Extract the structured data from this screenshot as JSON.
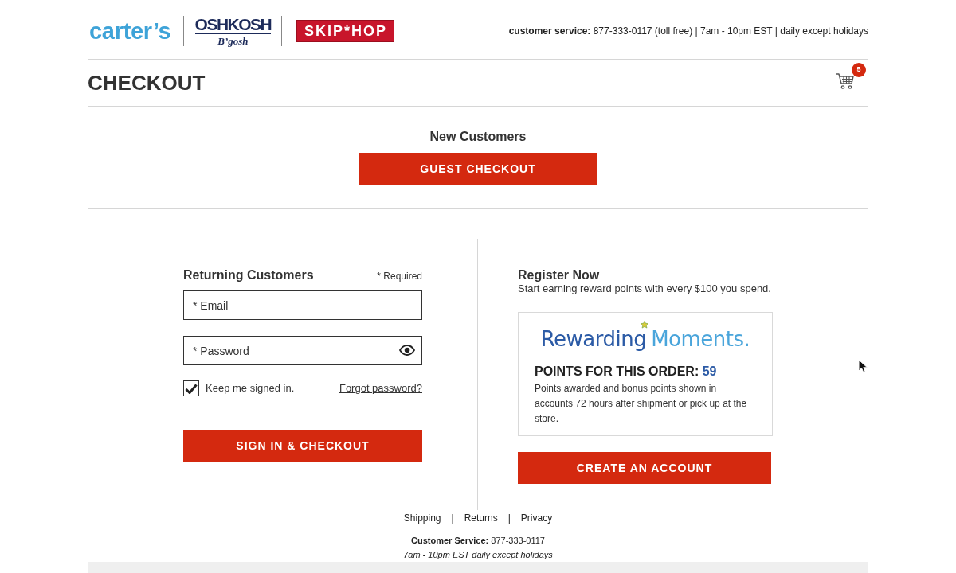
{
  "header": {
    "brands": [
      {
        "kind": "carters",
        "text": "carter’s"
      },
      {
        "kind": "oshkosh",
        "text": "OSHKOSH",
        "subtext": "B’gosh"
      },
      {
        "kind": "skiphop",
        "text": "SKIP*HOP"
      }
    ],
    "service_info": "**customer service:** 877-333-0117 (toll free) |  7am - 10pm EST |  daily except holidays"
  },
  "page_title": "CHECKOUT",
  "cart": {
    "count": "5"
  },
  "new_customers": {
    "heading": "New Customers",
    "button": "GUEST CHECKOUT"
  },
  "returning_customers": {
    "heading": "Returning Customers",
    "required_note": "* Required",
    "fields": [
      {
        "kind": "email",
        "placeholder": "* Email"
      },
      {
        "kind": "password",
        "placeholder": "* Password"
      }
    ],
    "keep_signed_in": {
      "label": "Keep me signed in.",
      "checked": true
    },
    "forgot_link": "Forgot password?",
    "button": "SIGN IN & CHECKOUT"
  },
  "register": {
    "heading": "Register Now",
    "subtitle": "Start earning reward points with every $100 you spend.",
    "rewards": {
      "logo_words": [
        "Rewarding",
        "Moments."
      ],
      "points_label": "POINTS FOR THIS ORDER:",
      "points": "59",
      "note": "Points awarded and bonus points shown in accounts 72 hours after shipment or pick up at the store."
    },
    "button": "CREATE AN ACCOUNT"
  },
  "footer": {
    "links": [
      "Shipping",
      "Returns",
      "Privacy"
    ],
    "separators": [
      "|",
      "|"
    ],
    "service": "**Customer Service:** 877-333-0117",
    "hours": "7am - 10pm EST daily except holidays"
  }
}
